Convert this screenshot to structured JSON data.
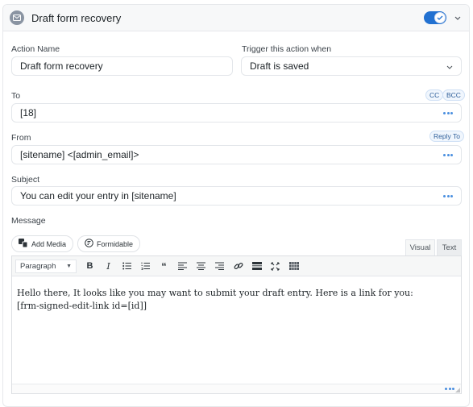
{
  "header": {
    "title": "Draft form recovery",
    "icon": "mail-icon",
    "toggle_enabled": true
  },
  "form": {
    "action_name": {
      "label": "Action Name",
      "value": "Draft form recovery"
    },
    "trigger": {
      "label": "Trigger this action when",
      "value": "Draft is saved"
    },
    "to": {
      "label": "To",
      "value": "[18]",
      "cc_label": "CC",
      "bcc_label": "BCC"
    },
    "from": {
      "label": "From",
      "value": "[sitename] <[admin_email]>",
      "reply_to_label": "Reply To"
    },
    "subject": {
      "label": "Subject",
      "value": "You can edit your entry in [sitename]"
    },
    "message": {
      "label": "Message",
      "add_media_label": "Add Media",
      "formidable_label": "Formidable",
      "tab_visual": "Visual",
      "tab_text": "Text",
      "format_value": "Paragraph",
      "content_line1": "Hello there, It looks like you may want to submit your draft entry. Here is a link for you:",
      "content_line2": "[frm-signed-edit-link id=[id]]"
    }
  },
  "colors": {
    "accent": "#2271d1"
  }
}
